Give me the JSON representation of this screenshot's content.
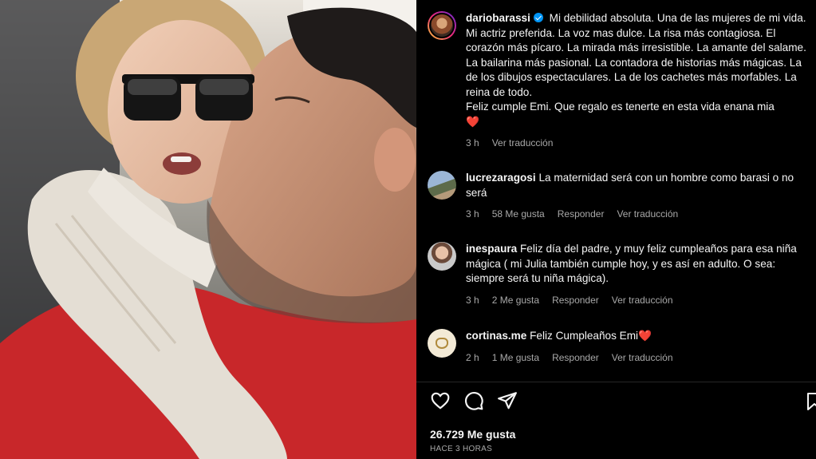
{
  "post": {
    "username": "dariobarassi",
    "caption": "Mi debilidad absoluta. Una de las mujeres de mi vida. Mi actriz preferida. La voz mas dulce. La risa más contagiosa. El corazón más pícaro. La mirada más irresistible. La amante del salame. La bailarina más pasional. La contadora de historias más mágicas. La de los dibujos espectaculares. La de los cachetes más morfables. La reina de todo.\nFeliz cumple Emi. Que regalo es tenertе en esta vida enana mia",
    "caption_emoji": "❤️",
    "time": "3 h",
    "translate": "Ver traducción",
    "likes": "26.729 Me gusta",
    "ago": "HACE 3 HORAS"
  },
  "comments": [
    {
      "username": "lucrezaragosi",
      "text": "La maternidad será con un hombre como barasi o no será",
      "time": "3 h",
      "likes": "58 Me gusta",
      "reply": "Responder",
      "translate": "Ver traducción"
    },
    {
      "username": "inespaura",
      "text": "Feliz día del padre, y muy feliz cumpleaños para esa niña mágica ( mi Julia también cumple hoy, y es así en adulto. O sea: siempre será tu niña mágica).",
      "time": "3 h",
      "likes": "2 Me gusta",
      "reply": "Responder",
      "translate": "Ver traducción"
    },
    {
      "username": "cortinas.me",
      "text": "Feliz Cumpleaños Emi",
      "emoji": "❤️",
      "time": "2 h",
      "likes": "1 Me gusta",
      "reply": "Responder",
      "translate": "Ver traducción"
    }
  ],
  "icons": [
    "heart-icon",
    "comment-icon",
    "share-icon",
    "save-icon",
    "verified-icon",
    "sunglasses-emoji"
  ],
  "colors": {
    "background": "#000000",
    "muted": "#a8a8a8",
    "verified": "#0095f6",
    "heart": "#e0173b"
  }
}
